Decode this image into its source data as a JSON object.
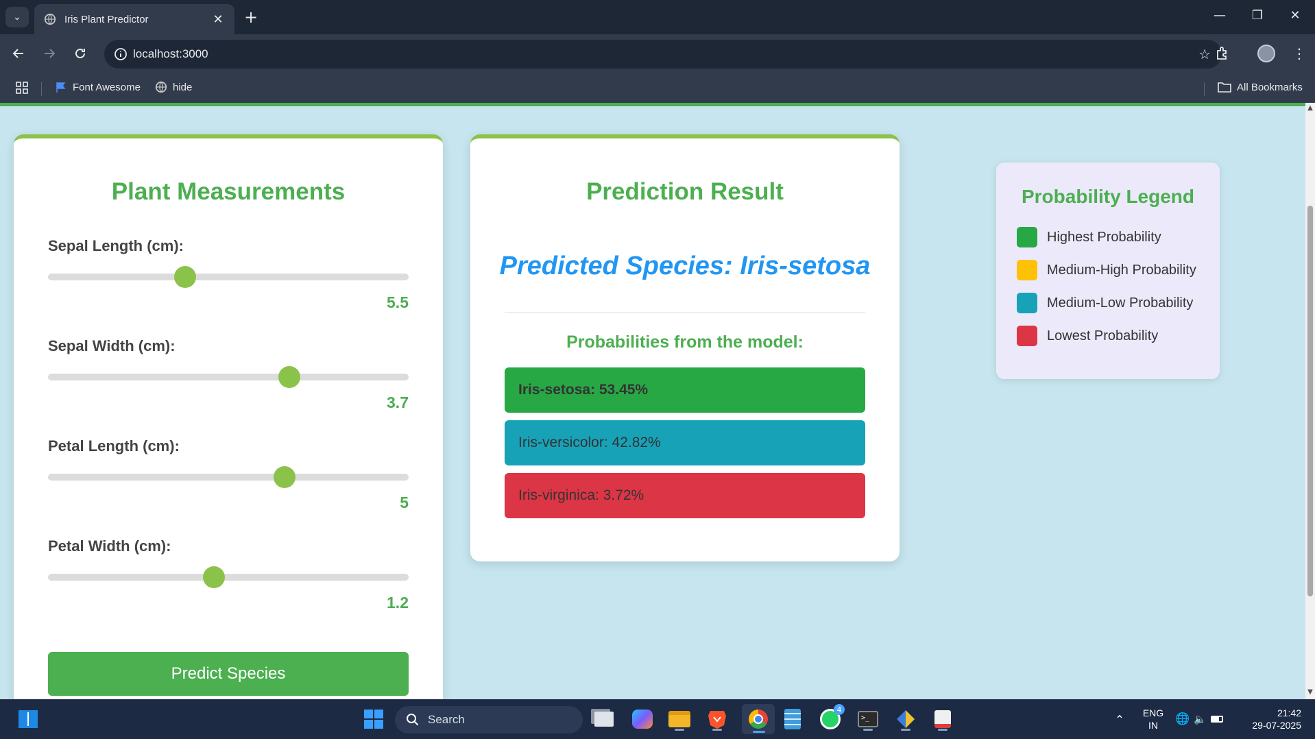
{
  "browser": {
    "tab_title": "Iris Plant Predictor",
    "url": "localhost:3000",
    "bookmarks": [
      {
        "label": "Font Awesome"
      },
      {
        "label": "hide"
      }
    ],
    "all_bookmarks_label": "All Bookmarks"
  },
  "measurements": {
    "title": "Plant Measurements",
    "sliders": [
      {
        "label": "Sepal Length (cm):",
        "value": "5.5",
        "fraction": 0.38
      },
      {
        "label": "Sepal Width (cm):",
        "value": "3.7",
        "fraction": 0.67
      },
      {
        "label": "Petal Length (cm):",
        "value": "5",
        "fraction": 0.656
      },
      {
        "label": "Petal Width (cm):",
        "value": "1.2",
        "fraction": 0.46
      }
    ],
    "button_label": "Predict Species"
  },
  "prediction": {
    "title": "Prediction Result",
    "species_text": "Predicted Species: Iris-setosa",
    "probabilities_heading": "Probabilities from the model:",
    "bars": [
      {
        "text": "Iris-setosa: 53.45%",
        "color": "#28a745",
        "bold": true
      },
      {
        "text": "Iris-versicolor: 42.82%",
        "color": "#17a2b8",
        "bold": false
      },
      {
        "text": "Iris-virginica: 3.72%",
        "color": "#dc3545",
        "bold": false
      }
    ]
  },
  "legend": {
    "title": "Probability Legend",
    "items": [
      {
        "label": "Highest Probability",
        "color": "#28a745"
      },
      {
        "label": "Medium-High Probability",
        "color": "#ffc107"
      },
      {
        "label": "Medium-Low Probability",
        "color": "#17a2b8"
      },
      {
        "label": "Lowest Probability",
        "color": "#dc3545"
      }
    ]
  },
  "taskbar": {
    "search_label": "Search",
    "whatsapp_badge": "4",
    "lang_line1": "ENG",
    "lang_line2": "IN",
    "time": "21:42",
    "date": "29-07-2025"
  }
}
